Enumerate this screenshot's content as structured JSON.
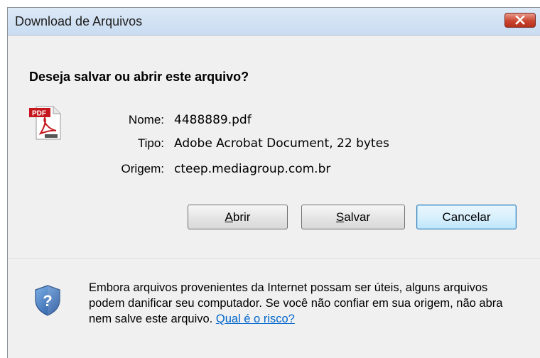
{
  "window": {
    "title": "Download de Arquivos"
  },
  "dialog": {
    "question": "Deseja salvar ou abrir este arquivo?",
    "file_icon": "pdf-file-icon",
    "fields": {
      "name_label": "Nome:",
      "name_value": "4488889.pdf",
      "type_label": "Tipo:",
      "type_value": "Adobe Acrobat Document, 22 bytes",
      "origin_label": "Origem:",
      "origin_value": "cteep.mediagroup.com.br"
    },
    "buttons": {
      "open_first": "A",
      "open_rest": "brir",
      "save_first": "S",
      "save_rest": "alvar",
      "cancel": "Cancelar"
    }
  },
  "footer": {
    "shield_icon": "security-shield-icon",
    "warning_text": "Embora arquivos provenientes da Internet possam ser úteis, alguns arquivos podem danificar seu computador. Se você não confiar em sua origem, não abra nem salve este arquivo.",
    "risk_link": "Qual é o risco?"
  },
  "colors": {
    "titlebar": "#c9dcf1",
    "close_button": "#c9452f",
    "link": "#0066cc",
    "dialog_bg": "#f0f0f0"
  }
}
